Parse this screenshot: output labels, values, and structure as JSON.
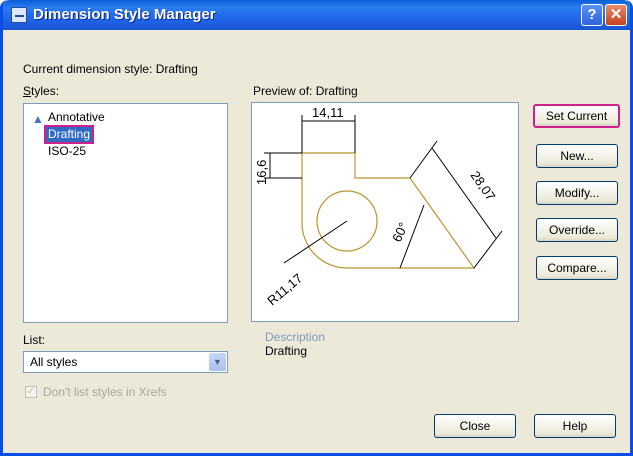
{
  "window": {
    "title": "Dimension Style Manager"
  },
  "current_style": {
    "label": "Current dimension style: Drafting"
  },
  "styles": {
    "label": "Styles:",
    "items": [
      {
        "name": "Annotative",
        "icon": "annotative-icon"
      },
      {
        "name": "Drafting",
        "selected": true
      },
      {
        "name": "ISO-25"
      }
    ]
  },
  "list": {
    "label": "List:",
    "value": "All styles"
  },
  "dont_list": {
    "label": "Don't list styles in Xrefs",
    "checked": true,
    "disabled": true
  },
  "preview": {
    "label": "Preview of: Drafting",
    "dims": {
      "top": "14,11",
      "left": "16,6",
      "diag": "28,07",
      "angle": "60°",
      "radius": "R11,17"
    }
  },
  "description": {
    "label": "Description",
    "value": "Drafting"
  },
  "buttons": {
    "set_current": "Set Current",
    "new": "New...",
    "modify": "Modify...",
    "override": "Override...",
    "compare": "Compare...",
    "close": "Close",
    "help": "Help"
  },
  "colors": {
    "titlebar": "#0a5fd8",
    "highlight_outline": "#d0208a",
    "selection": "#316ac5",
    "drawing": "#b8962e"
  }
}
